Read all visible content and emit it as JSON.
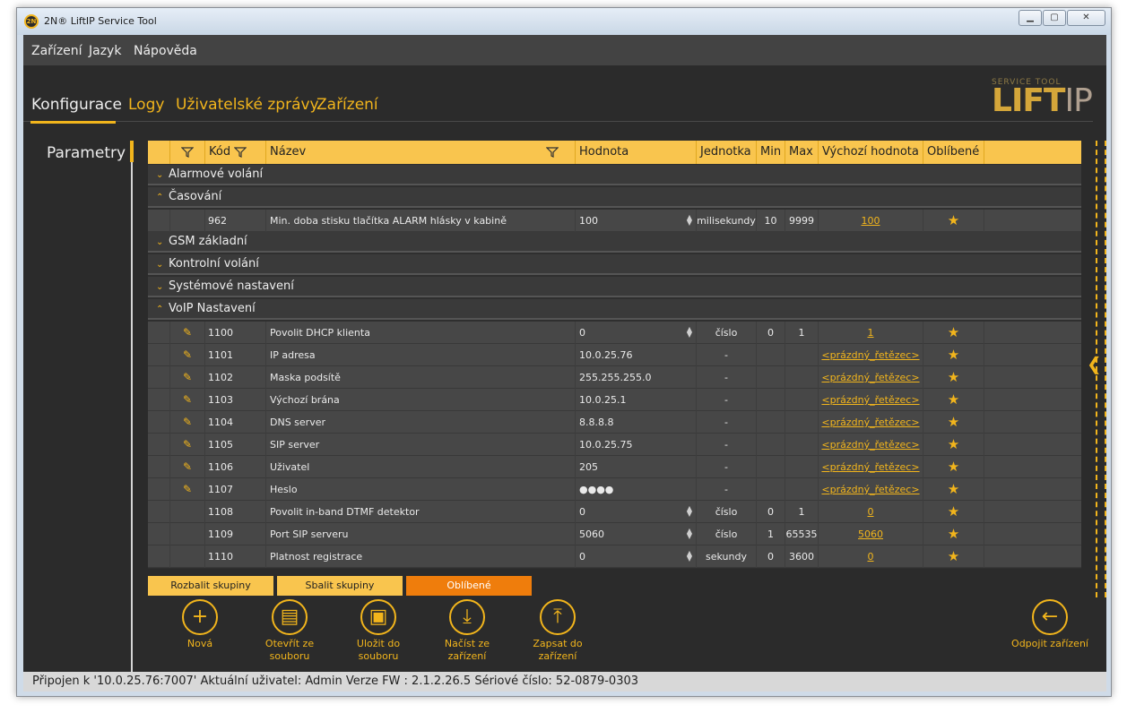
{
  "window": {
    "title": "2N® LiftIP Service Tool",
    "icon": "2n-logo-icon"
  },
  "menu": [
    "Zařízení",
    "Jazyk",
    "Nápověda"
  ],
  "tabs": [
    {
      "label": "Konfigurace",
      "active": true
    },
    {
      "label": "Logy",
      "active": false
    },
    {
      "label": "Uživatelské zprávy",
      "active": false
    },
    {
      "label": "Zařízení",
      "active": false
    }
  ],
  "logo": {
    "top": "SERVICE TOOL",
    "main": "LIFT",
    "suffix": "IP"
  },
  "sidebar": {
    "title": "Parametry"
  },
  "grid": {
    "columns": [
      "Kód",
      "Název",
      "Hodnota",
      "Jednotka",
      "Min",
      "Max",
      "Výchozí hodnota",
      "Oblíbené"
    ],
    "groups": [
      {
        "label": "Alarmové volání",
        "expanded": false
      },
      {
        "label": "Časování",
        "expanded": true
      },
      {
        "label": "GSM základní",
        "expanded": false
      },
      {
        "label": "Kontrolní volání",
        "expanded": false
      },
      {
        "label": "Systémové nastavení",
        "expanded": false
      },
      {
        "label": "VoIP Nastavení",
        "expanded": true
      }
    ],
    "timing_rows": [
      {
        "code": "962",
        "name": "Min. doba stisku tlačítka ALARM hlásky v kabině",
        "value": "100",
        "unit": "milisekundy",
        "min": "10",
        "max": "9999",
        "default": "100",
        "editable": false,
        "spinner": true
      }
    ],
    "voip_rows": [
      {
        "code": "1100",
        "name": "Povolit DHCP klienta",
        "value": "0",
        "unit": "číslo",
        "min": "0",
        "max": "1",
        "default": "1",
        "editable": true,
        "spinner": true
      },
      {
        "code": "1101",
        "name": "IP adresa",
        "value": "10.0.25.76",
        "unit": "-",
        "min": "",
        "max": "",
        "default": "<prázdný_řetězec>",
        "editable": true,
        "spinner": false
      },
      {
        "code": "1102",
        "name": "Maska podsítě",
        "value": "255.255.255.0",
        "unit": "-",
        "min": "",
        "max": "",
        "default": "<prázdný_řetězec>",
        "editable": true,
        "spinner": false
      },
      {
        "code": "1103",
        "name": "Výchozí brána",
        "value": "10.0.25.1",
        "unit": "-",
        "min": "",
        "max": "",
        "default": "<prázdný_řetězec>",
        "editable": true,
        "spinner": false
      },
      {
        "code": "1104",
        "name": "DNS server",
        "value": "8.8.8.8",
        "unit": "-",
        "min": "",
        "max": "",
        "default": "<prázdný_řetězec>",
        "editable": true,
        "spinner": false
      },
      {
        "code": "1105",
        "name": "SIP server",
        "value": "10.0.25.75",
        "unit": "-",
        "min": "",
        "max": "",
        "default": "<prázdný_řetězec>",
        "editable": true,
        "spinner": false
      },
      {
        "code": "1106",
        "name": "Uživatel",
        "value": "205",
        "unit": "-",
        "min": "",
        "max": "",
        "default": "<prázdný_řetězec>",
        "editable": true,
        "spinner": false
      },
      {
        "code": "1107",
        "name": "Heslo",
        "value": "●●●●",
        "unit": "-",
        "min": "",
        "max": "",
        "default": "<prázdný_řetězec>",
        "editable": true,
        "spinner": false
      },
      {
        "code": "1108",
        "name": "Povolit in-band DTMF detektor",
        "value": "0",
        "unit": "číslo",
        "min": "0",
        "max": "1",
        "default": "0",
        "editable": false,
        "spinner": true
      },
      {
        "code": "1109",
        "name": "Port SIP serveru",
        "value": "5060",
        "unit": "číslo",
        "min": "1",
        "max": "65535",
        "default": "5060",
        "editable": false,
        "spinner": true
      },
      {
        "code": "1110",
        "name": "Platnost registrace",
        "value": "0",
        "unit": "sekundy",
        "min": "0",
        "max": "3600",
        "default": "0",
        "editable": false,
        "spinner": true
      }
    ]
  },
  "buttons": {
    "expand": "Rozbalit skupiny",
    "collapse": "Sbalit skupiny",
    "favorites": "Oblíbené"
  },
  "actions": [
    {
      "label": "Nová",
      "icon": "plus-icon",
      "glyph": "+"
    },
    {
      "label": "Otevřít ze\nsouboru",
      "icon": "open-file-icon",
      "glyph": "▤"
    },
    {
      "label": "Uložit do\nsouboru",
      "icon": "save-icon",
      "glyph": "▣"
    },
    {
      "label": "Načíst ze\nzařízení",
      "icon": "download-icon",
      "glyph": "⤓"
    },
    {
      "label": "Zapsat do\nzařízení",
      "icon": "upload-icon",
      "glyph": "⤒"
    }
  ],
  "disconnect": {
    "label": "Odpojit zařízení",
    "icon": "back-arrow-icon",
    "glyph": "←"
  },
  "status": "Připojen k '10.0.25.76:7007'  Aktuální uživatel: Admin  Verze FW : 2.1.2.26.5  Sériové číslo: 52-0879-0303",
  "colors": {
    "accent": "#f2b51c",
    "header": "#f9c54e",
    "favorites_button": "#ef7d0c",
    "background": "#2b2b2b"
  }
}
